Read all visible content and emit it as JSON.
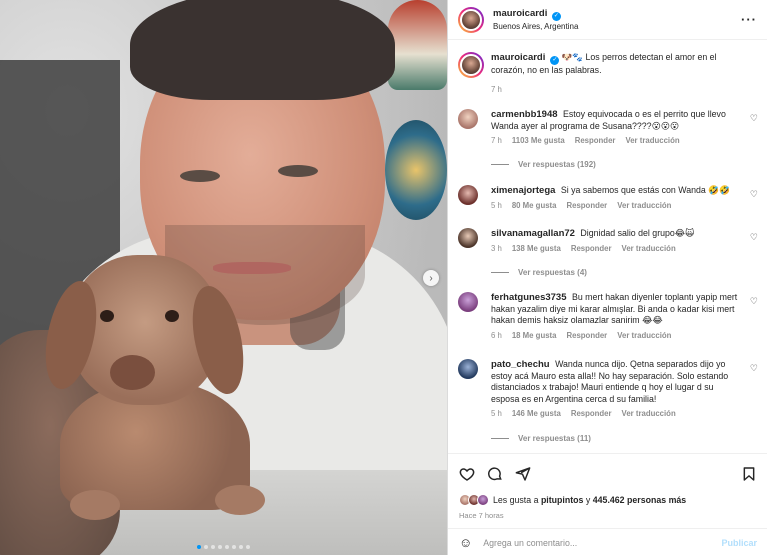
{
  "post": {
    "author": "mauroicardi",
    "location": "Buenos Aires, Argentina",
    "caption_text": "Los perros detectan el amor en el corazón, no en las palabras.",
    "caption_emoji": "🐶🐾",
    "caption_time": "7 h",
    "more_label": "···",
    "next_label": "›",
    "image_count": 8,
    "current_image": 1
  },
  "comments": [
    {
      "user": "carmenbb1948",
      "text": "Estoy equivocada o es el perrito que llevo Wanda ayer al programa de Susana????😮😮😮",
      "time": "7 h",
      "likes": "1103 Me gusta",
      "reply": "Responder",
      "translate": "Ver traducción",
      "replies": "Ver respuestas (192)"
    },
    {
      "user": "ximenajortega",
      "text": "Si ya sabemos que estás con Wanda 🤣🤣",
      "time": "5 h",
      "likes": "80 Me gusta",
      "reply": "Responder",
      "translate": "Ver traducción",
      "replies": ""
    },
    {
      "user": "silvanamagallan72",
      "text": "Dignidad salio del grupo😂🙀",
      "time": "3 h",
      "likes": "138 Me gusta",
      "reply": "Responder",
      "translate": "Ver traducción",
      "replies": "Ver respuestas (4)"
    },
    {
      "user": "ferhatgunes3735",
      "text": "Bu mert hakan diyenler toplantı yapip mert hakan yazalim diye mi karar almışlar. Bi anda o kadar kisi mert hakan demis haksiz olamazlar sanirim 😂😂",
      "time": "6 h",
      "likes": "18 Me gusta",
      "reply": "Responder",
      "translate": "Ver traducción",
      "replies": ""
    },
    {
      "user": "pato_chechu",
      "text": "Wanda nunca dijo. Qetna separados dijo yo estoy acá Mauro esta alla!! No hay separación. Solo estando distanciados x trabajo! Mauri entiende q hoy el lugar d su esposa es en Argentina cerca d su familia!",
      "time": "5 h",
      "likes": "146 Me gusta",
      "reply": "Responder",
      "translate": "Ver traducción",
      "replies": "Ver respuestas (11)"
    }
  ],
  "likes_bar": {
    "prefix": "Les gusta a",
    "liker": "pitupintos",
    "connector": "y",
    "others": "445.462 personas más"
  },
  "time_ago": "Hace 7 horas",
  "add_comment": {
    "placeholder": "Agrega un comentario...",
    "publish": "Publicar",
    "emoji_icon": "☺"
  }
}
